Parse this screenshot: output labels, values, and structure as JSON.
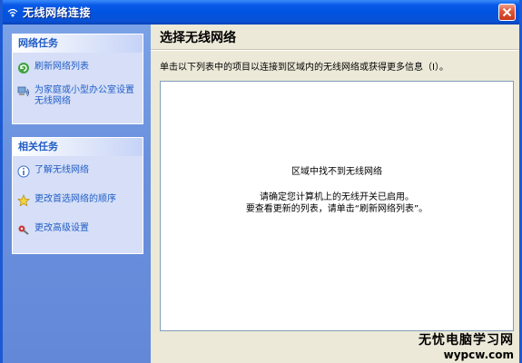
{
  "window": {
    "title": "无线网络连接",
    "title_icon": "wireless-icon"
  },
  "sidebar": {
    "network_tasks": {
      "header": "网络任务",
      "items": [
        {
          "label": "刷新网络列表",
          "icon": "refresh-icon"
        },
        {
          "label": "为家庭或小型办公室设置无线网络",
          "icon": "setup-network-icon"
        }
      ]
    },
    "related_tasks": {
      "header": "相关任务",
      "items": [
        {
          "label": "了解无线网络",
          "icon": "info-icon"
        },
        {
          "label": "更改首选网络的顺序",
          "icon": "star-icon"
        },
        {
          "label": "更改高级设置",
          "icon": "settings-icon"
        }
      ]
    }
  },
  "main": {
    "heading": "选择无线网络",
    "instruction": "单击以下列表中的项目以连接到区域内的无线网络或获得更多信息（I）。",
    "list": {
      "message_title": "区域中找不到无线网络",
      "message_line1": "请确定您计算机上的无线开关已启用。",
      "message_line2": "要查看更新的列表，请单击“刷新网络列表”。"
    }
  },
  "watermark": {
    "line1": "无忧电脑学习网",
    "line2": "wypcw.com"
  },
  "colors": {
    "titlebar": "#0053E1",
    "sidebar": "#6A91DE",
    "panel_text": "#215DC6",
    "main_bg": "#ECE9D8",
    "close_button": "#E1583A"
  }
}
